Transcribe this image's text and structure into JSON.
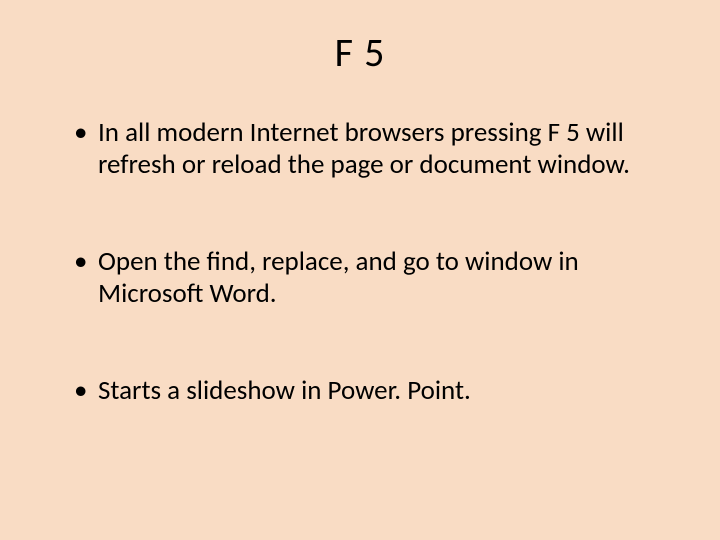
{
  "slide": {
    "title": "F 5",
    "bullets": [
      "In all modern Internet browsers pressing F 5 will refresh or reload the page or document window.",
      "Open the find, replace, and go to window in Microsoft Word.",
      "Starts a slideshow in Power. Point."
    ]
  }
}
